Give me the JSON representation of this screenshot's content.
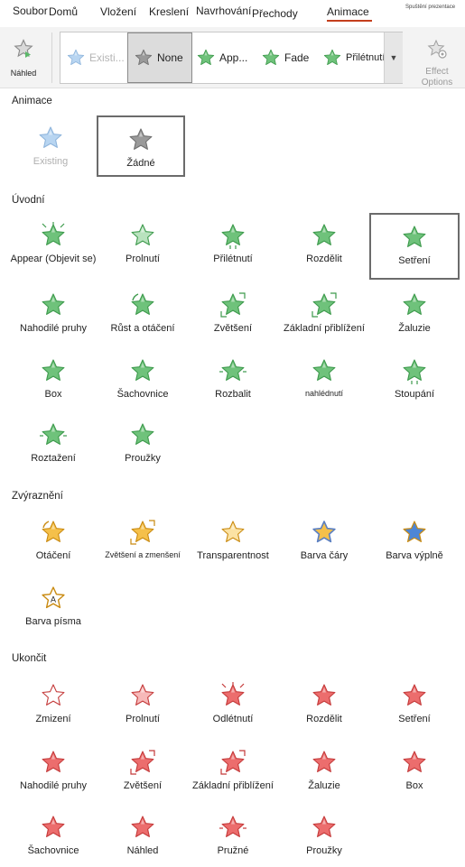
{
  "tabs": [
    {
      "label": "Soubor",
      "active": false
    },
    {
      "label": "Domů",
      "active": false
    },
    {
      "label": "Vložení",
      "active": false
    },
    {
      "label": "Kreslení",
      "active": false
    },
    {
      "label": "Navrhování",
      "active": false
    },
    {
      "label": "Přechody",
      "active": false
    },
    {
      "label": "Animace",
      "active": true
    }
  ],
  "tab_note": "Spuštění prezentace",
  "ribbon": {
    "preview_label": "Náhled",
    "gallery": [
      {
        "label": "Existi...",
        "icon": "star-blue-icon",
        "state": "disabled"
      },
      {
        "label": "None",
        "icon": "star-gray-icon",
        "state": "selected"
      },
      {
        "label": "App...",
        "icon": "star-green-icon",
        "state": "normal"
      },
      {
        "label": "Fade",
        "icon": "star-green-icon",
        "state": "normal"
      },
      {
        "label": "Přilétnutí",
        "icon": "star-green-icon",
        "state": "normal"
      }
    ],
    "effect_options_label": "Effect Options"
  },
  "colors": {
    "entrance": "#5cb86a",
    "emphasis": "#f2b331",
    "exit": "#e55a5a",
    "none": "#8c8c8c",
    "existing": "#9cc3ea",
    "accent_underline": "#c43e1c"
  },
  "sections": [
    {
      "title": "Animace",
      "items": [
        {
          "label": "Existing",
          "icon": "star-blue-icon",
          "state": "disabled"
        },
        {
          "label": "Žádné",
          "icon": "star-gray-icon",
          "state": "selected"
        }
      ]
    },
    {
      "title": "Úvodní",
      "items": [
        {
          "label": "Appear (Objevit se)",
          "icon": "star-green-burst-icon",
          "state": "normal"
        },
        {
          "label": "Prolnutí",
          "icon": "star-green-fade-icon",
          "state": "normal"
        },
        {
          "label": "Přilétnutí",
          "icon": "star-green-fly-icon",
          "state": "normal"
        },
        {
          "label": "Rozdělit",
          "icon": "star-green-split-icon",
          "state": "normal"
        },
        {
          "label": "Setření",
          "icon": "star-green-wipe-icon",
          "state": "selected"
        },
        {
          "label": "Nahodilé pruhy",
          "icon": "star-green-bars-icon",
          "state": "normal"
        },
        {
          "label": "Růst a otáčení",
          "icon": "star-green-grow-turn-icon",
          "state": "normal"
        },
        {
          "label": "Zvětšení",
          "icon": "star-green-zoom-icon",
          "state": "normal"
        },
        {
          "label": "Základní přiblížení",
          "icon": "star-green-basic-zoom-icon",
          "state": "normal"
        },
        {
          "label": "Žaluzie",
          "icon": "star-green-blinds-icon",
          "state": "normal"
        },
        {
          "label": "Box",
          "icon": "star-green-box-icon",
          "state": "normal"
        },
        {
          "label": "Šachovnice",
          "icon": "star-green-checkerboard-icon",
          "state": "normal"
        },
        {
          "label": "Rozbalit",
          "icon": "star-green-expand-icon",
          "state": "normal"
        },
        {
          "label": "nahlédnutí",
          "icon": "star-green-peek-icon",
          "state": "normal",
          "small": true
        },
        {
          "label": "Stoupání",
          "icon": "star-green-rise-icon",
          "state": "normal"
        },
        {
          "label": "Roztažení",
          "icon": "star-green-stretch-icon",
          "state": "normal"
        },
        {
          "label": "Proužky",
          "icon": "star-green-strips-icon",
          "state": "normal"
        }
      ]
    },
    {
      "title": "Zvýraznění",
      "items": [
        {
          "label": "Otáčení",
          "icon": "star-yellow-spin-icon",
          "state": "normal"
        },
        {
          "label": "Zvětšení a zmenšení",
          "icon": "star-yellow-grow-shrink-icon",
          "state": "normal",
          "small": true
        },
        {
          "label": "Transparentnost",
          "icon": "star-yellow-transparency-icon",
          "state": "normal"
        },
        {
          "label": "Barva čáry",
          "icon": "star-yellow-line-color-icon",
          "state": "normal"
        },
        {
          "label": "Barva výplně",
          "icon": "star-yellow-fill-color-icon",
          "state": "normal"
        },
        {
          "label": "Barva písma",
          "icon": "star-yellow-font-color-icon",
          "state": "normal"
        }
      ]
    },
    {
      "title": "Ukončit",
      "items": [
        {
          "label": "Zmizení",
          "icon": "star-red-disappear-icon",
          "state": "normal"
        },
        {
          "label": "Prolnutí",
          "icon": "star-red-fade-icon",
          "state": "normal"
        },
        {
          "label": "Odlétnutí",
          "icon": "star-red-fly-out-icon",
          "state": "normal"
        },
        {
          "label": "Rozdělit",
          "icon": "star-red-split-icon",
          "state": "normal"
        },
        {
          "label": "Setření",
          "icon": "star-red-wipe-icon",
          "state": "normal"
        },
        {
          "label": "Nahodilé pruhy",
          "icon": "star-red-bars-icon",
          "state": "normal"
        },
        {
          "label": "Zvětšení",
          "icon": "star-red-zoom-icon",
          "state": "normal"
        },
        {
          "label": "Základní přiblížení",
          "icon": "star-red-basic-zoom-icon",
          "state": "normal"
        },
        {
          "label": "Žaluzie",
          "icon": "star-red-blinds-icon",
          "state": "normal"
        },
        {
          "label": "Box",
          "icon": "star-red-box-icon",
          "state": "normal"
        },
        {
          "label": "Šachovnice",
          "icon": "star-red-checkerboard-icon",
          "state": "normal"
        },
        {
          "label": "Náhled",
          "icon": "star-red-peek-icon",
          "state": "normal"
        },
        {
          "label": "Pružné",
          "icon": "star-red-bounce-icon",
          "state": "normal"
        },
        {
          "label": "Proužky",
          "icon": "star-red-strips-icon",
          "state": "normal"
        }
      ]
    }
  ]
}
